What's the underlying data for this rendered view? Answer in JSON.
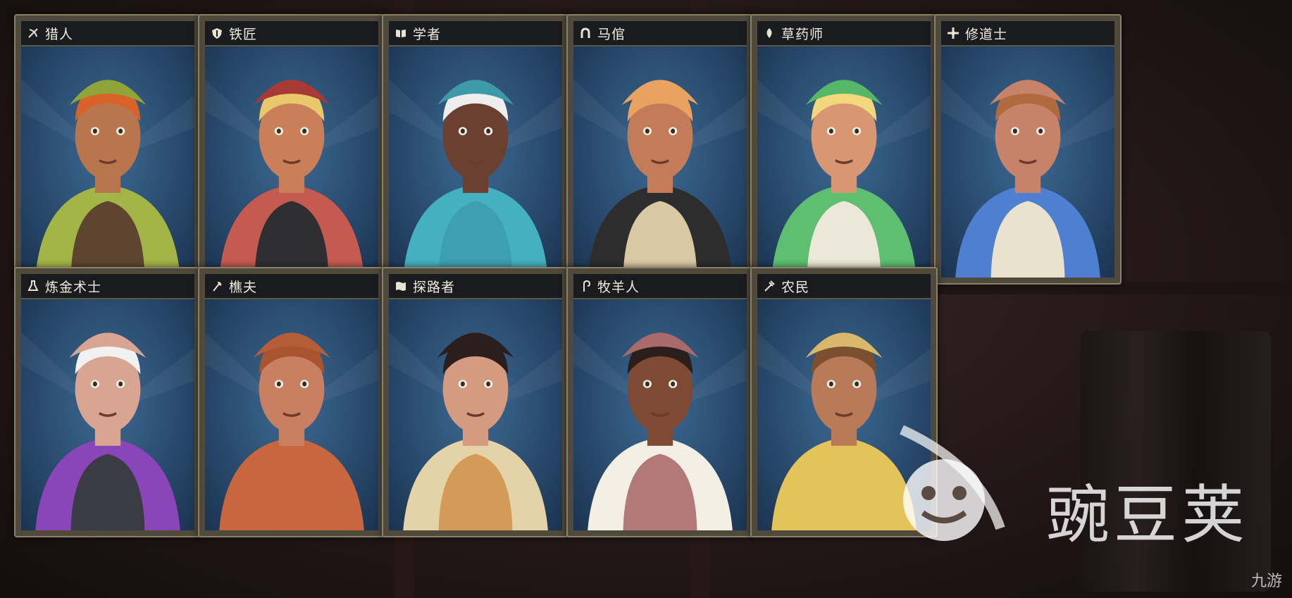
{
  "cards": [
    {
      "title": "猎人",
      "icon": "bow-icon",
      "skin": "#b8754e",
      "hair": "#d8622a",
      "hat": "#8fa53a",
      "shirt": "#a4b548",
      "vest": "#5e4530"
    },
    {
      "title": "铁匠",
      "icon": "shield-icon",
      "skin": "#c9805a",
      "hair": "#e8c86a",
      "hat": "#a83a35",
      "shirt": "#c45a50",
      "vest": "#2f2f32"
    },
    {
      "title": "学者",
      "icon": "book-icon",
      "skin": "#6b4030",
      "hair": "#eeeeee",
      "hat": "#3e9aa8",
      "shirt": "#45b1c0",
      "vest": "#3f9fb2"
    },
    {
      "title": "马倌",
      "icon": "horseshoe-icon",
      "skin": "#c47c58",
      "hair": "#e9a260",
      "hat": "#e9a260",
      "shirt": "#2e2d2e",
      "vest": "#d8c9a4"
    },
    {
      "title": "草药师",
      "icon": "leaf-icon",
      "skin": "#d89672",
      "hair": "#f2d77d",
      "hat": "#55b768",
      "shirt": "#5ebf70",
      "vest": "#ece7d8"
    },
    {
      "title": "修道士",
      "icon": "cross-icon",
      "skin": "#c7826a",
      "hair": "#b06a3e",
      "hat": "#c7826a",
      "shirt": "#4e7fd0",
      "vest": "#e8e2cf"
    },
    {
      "title": "炼金术士",
      "icon": "flask-icon",
      "skin": "#d7a592",
      "hair": "#f1f1f1",
      "hat": "#d7a592",
      "shirt": "#8a45b8",
      "vest": "#3b3b45"
    },
    {
      "title": "樵夫",
      "icon": "axe-icon",
      "skin": "#c98062",
      "hair": "#a7542f",
      "hat": "#b55d37",
      "shirt": "#c8673f",
      "vest": "#c8673f"
    },
    {
      "title": "探路者",
      "icon": "map-icon",
      "skin": "#d49b80",
      "hair": "#2a1f1c",
      "hat": "#2a1f1c",
      "shirt": "#e4d2a8",
      "vest": "#d49a58"
    },
    {
      "title": "牧羊人",
      "icon": "crook-icon",
      "skin": "#7e4a34",
      "hair": "#2b1f1b",
      "hat": "#a86a6a",
      "shirt": "#f3efe5",
      "vest": "#b37878"
    },
    {
      "title": "农民",
      "icon": "pitchfork-icon",
      "skin": "#b87a58",
      "hair": "#7a5030",
      "hat": "#d8b86a",
      "shirt": "#e4c45a",
      "vest": "#e4c45a"
    }
  ],
  "watermark": {
    "brand": "豌豆荚",
    "corner": "九游"
  },
  "colors": {
    "frame": "#8b8168",
    "header": "#1a1b1e",
    "portrait_bg": "#2a4c70"
  }
}
